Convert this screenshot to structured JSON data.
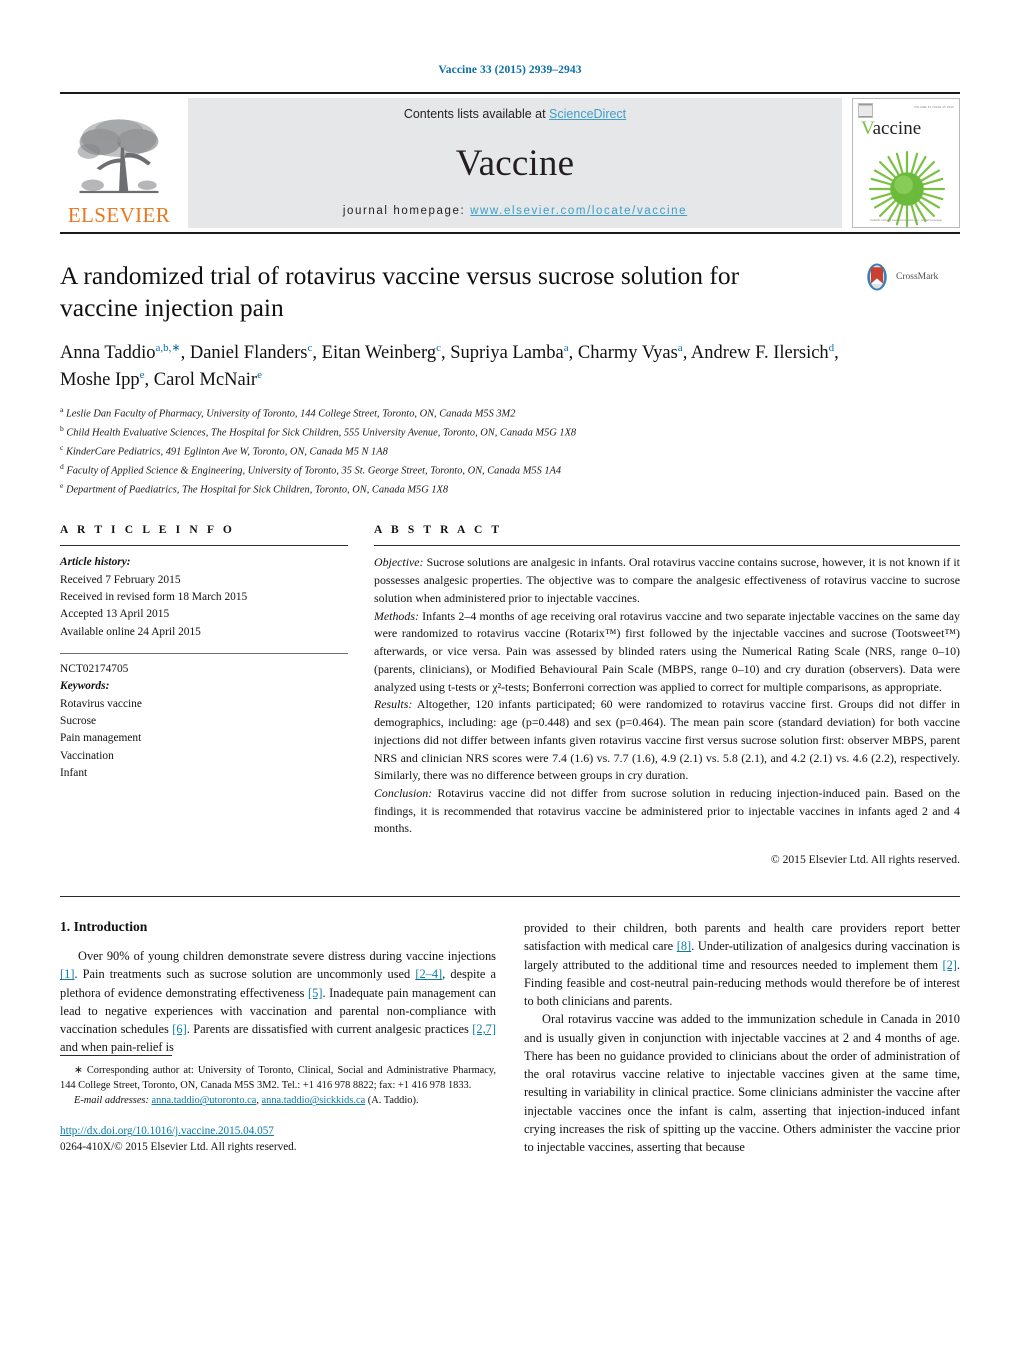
{
  "running_head": "Vaccine 33 (2015) 2939–2943",
  "masthead": {
    "publisher_name": "ELSEVIER",
    "contents_prefix": "Contents lists available at ",
    "contents_link": "ScienceDirect",
    "journal_title": "Vaccine",
    "homepage_prefix": "journal homepage: ",
    "homepage_url": "www.elsevier.com/locate/vaccine",
    "cover": {
      "journal_name_initial": "V",
      "journal_name_rest": "accine",
      "top_meta": "VOLUME 33  ISSUE 25  2015",
      "footer_meta": "Available online at www.sciencedirect.com · journal homepage"
    }
  },
  "article": {
    "title": "A randomized trial of rotavirus vaccine versus sucrose solution for vaccine injection pain",
    "crossmark_label": "CrossMark",
    "authors_html": "Anna Taddio<sup>a,b,</sup><sup class=\"star\">∗</sup>, Daniel Flanders<sup>c</sup>, Eitan Weinberg<sup>c</sup>, Supriya Lamba<sup>a</sup>, Charmy Vyas<sup>a</sup>, Andrew F. Ilersich<sup>d</sup>, Moshe Ipp<sup>e</sup>, Carol McNair<sup>e</sup>",
    "affiliations": [
      {
        "marker": "a",
        "text": "Leslie Dan Faculty of Pharmacy, University of Toronto, 144 College Street, Toronto, ON, Canada M5S 3M2"
      },
      {
        "marker": "b",
        "text": "Child Health Evaluative Sciences, The Hospital for Sick Children, 555 University Avenue, Toronto, ON, Canada M5G 1X8"
      },
      {
        "marker": "c",
        "text": "KinderCare Pediatrics, 491 Eglinton Ave W, Toronto, ON, Canada M5 N 1A8"
      },
      {
        "marker": "d",
        "text": "Faculty of Applied Science & Engineering, University of Toronto, 35 St. George Street, Toronto, ON, Canada M5S 1A4"
      },
      {
        "marker": "e",
        "text": "Department of Paediatrics, The Hospital for Sick Children, Toronto, ON, Canada M5G 1X8"
      }
    ]
  },
  "article_info": {
    "heading": "A R T I C L E   I N F O",
    "history_label": "Article history:",
    "history": [
      "Received 7 February 2015",
      "Received in revised form 18 March 2015",
      "Accepted 13 April 2015",
      "Available online 24 April 2015"
    ],
    "trial_number": "NCT02174705",
    "keywords_label": "Keywords:",
    "keywords": [
      "Rotavirus vaccine",
      "Sucrose",
      "Pain management",
      "Vaccination",
      "Infant"
    ]
  },
  "abstract": {
    "heading": "A B S T R A C T",
    "sections": [
      {
        "label": "Objective:",
        "text": " Sucrose solutions are analgesic in infants. Oral rotavirus vaccine contains sucrose, however, it is not known if it possesses analgesic properties. The objective was to compare the analgesic effectiveness of rotavirus vaccine to sucrose solution when administered prior to injectable vaccines."
      },
      {
        "label": "Methods:",
        "text": " Infants 2–4 months of age receiving oral rotavirus vaccine and two separate injectable vaccines on the same day were randomized to rotavirus vaccine (Rotarix™) first followed by the injectable vaccines and sucrose (Tootsweet™) afterwards, or vice versa. Pain was assessed by blinded raters using the Numerical Rating Scale (NRS, range 0–10) (parents, clinicians), or Modified Behavioural Pain Scale (MBPS, range 0–10) and cry duration (observers). Data were analyzed using t-tests or χ²-tests; Bonferroni correction was applied to correct for multiple comparisons, as appropriate."
      },
      {
        "label": "Results:",
        "text": " Altogether, 120 infants participated; 60 were randomized to rotavirus vaccine first. Groups did not differ in demographics, including: age (p=0.448) and sex (p=0.464). The mean pain score (standard deviation) for both vaccine injections did not differ between infants given rotavirus vaccine first versus sucrose solution first: observer MBPS, parent NRS and clinician NRS scores were 7.4 (1.6) vs. 7.7 (1.6), 4.9 (2.1) vs. 5.8 (2.1), and 4.2 (2.1) vs. 4.6 (2.2), respectively. Similarly, there was no difference between groups in cry duration."
      },
      {
        "label": "Conclusion:",
        "text": " Rotavirus vaccine did not differ from sucrose solution in reducing injection-induced pain. Based on the findings, it is recommended that rotavirus vaccine be administered prior to injectable vaccines in infants aged 2 and 4 months."
      }
    ],
    "copyright": "© 2015 Elsevier Ltd. All rights reserved."
  },
  "introduction": {
    "heading": "1.  Introduction",
    "left_paragraphs": [
      {
        "parts": [
          {
            "t": "Over 90% of young children demonstrate severe distress during vaccine injections "
          },
          {
            "t": "[1]",
            "ref": true
          },
          {
            "t": ". Pain treatments such as sucrose solution are uncommonly used "
          },
          {
            "t": "[2–4]",
            "ref": true
          },
          {
            "t": ", despite a plethora of evidence demonstrating effectiveness "
          },
          {
            "t": "[5]",
            "ref": true
          },
          {
            "t": ". Inadequate pain management can lead to negative experiences with vaccination and parental non-compliance with vaccination schedules "
          },
          {
            "t": "[6]",
            "ref": true
          },
          {
            "t": ". Parents are dissatisfied with current analgesic practices "
          },
          {
            "t": "[2,7]",
            "ref": true
          },
          {
            "t": " and when pain-relief is"
          }
        ]
      }
    ],
    "right_paragraphs": [
      {
        "indent": false,
        "parts": [
          {
            "t": "provided to their children, both parents and health care providers report better satisfaction with medical care "
          },
          {
            "t": "[8]",
            "ref": true
          },
          {
            "t": ". Under-utilization of analgesics during vaccination is largely attributed to the additional time and resources needed to implement them "
          },
          {
            "t": "[2]",
            "ref": true
          },
          {
            "t": ". Finding feasible and cost-neutral pain-reducing methods would therefore be of interest to both clinicians and parents."
          }
        ]
      },
      {
        "indent": true,
        "parts": [
          {
            "t": "Oral rotavirus vaccine was added to the immunization schedule in Canada in 2010 and is usually given in conjunction with injectable vaccines at 2 and 4 months of age. There has been no guidance provided to clinicians about the order of administration of the oral rotavirus vaccine relative to injectable vaccines given at the same time, resulting in variability in clinical practice. Some clinicians administer the vaccine after injectable vaccines once the infant is calm, asserting that injection-induced infant crying increases the risk of spitting up the vaccine. Others administer the vaccine prior to injectable vaccines, asserting that because"
          }
        ]
      }
    ]
  },
  "footnotes": {
    "corresponding_marker": "∗",
    "corresponding_text": " Corresponding author at: University of Toronto, Clinical, Social and Administrative Pharmacy, 144 College Street, Toronto, ON, Canada M5S 3M2. Tel.: +1 416 978 8822; fax: +1 416 978 1833.",
    "email_label": "E-mail addresses:",
    "email_1": "anna.taddio@utoronto.ca",
    "email_2": "anna.taddio@sickkids.ca",
    "email_attrib": "(A. Taddio).",
    "doi": "http://dx.doi.org/10.1016/j.vaccine.2015.04.057",
    "issn_line": "0264-410X/© 2015 Elsevier Ltd. All rights reserved."
  },
  "colors": {
    "link": "#0b7ba8",
    "running_head": "#0b6ea8",
    "elsevier_orange": "#E87722",
    "band_gray": "#e6e7e8",
    "cover_green": "#7ac143"
  }
}
